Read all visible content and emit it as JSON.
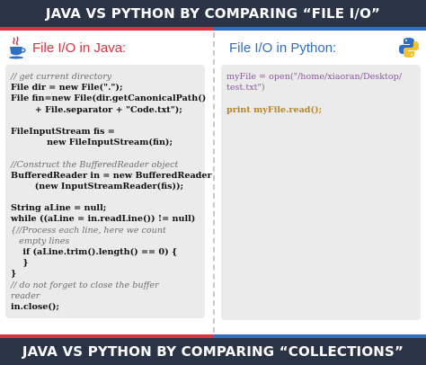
{
  "header": {
    "title": "JAVA VS PYTHON BY COMPARING “FILE I/O”"
  },
  "footer": {
    "title": "JAVA VS PYTHON BY COMPARING “COLLECTIONS”"
  },
  "colors": {
    "banner": "#2b3447",
    "java_accent": "#d9343f",
    "python_accent": "#2f6fc4",
    "code_bg": "#ebebeb"
  },
  "java": {
    "title": "File I/O in Java:",
    "icon": "java-cup-icon",
    "code_lines": [
      "// get current directory",
      "File dir = new File(\".\");",
      "File fin=new File(dir.getCanonicalPath()",
      "        + File.separator + \"Code.txt\");",
      "",
      "FileInputStream fis =",
      "            new FileInputStream(fin);",
      "",
      "//Construct the BufferedReader object",
      "BufferedReader in = new BufferedReader",
      "        (new InputStreamReader(fis));",
      "",
      "String aLine = null;",
      "while ((aLine = in.readLine()) != null)",
      "{//Process each line, here we count",
      "   empty lines",
      "    if (aLine.trim().length() == 0) {",
      "    }",
      "}",
      "// do not forget to close the buffer",
      "reader",
      "in.close();"
    ]
  },
  "python": {
    "title": "File I/O in Python:",
    "icon": "python-logo-icon",
    "code_lines": [
      "myFile = open(\"/home/xiaoran/Desktop/",
      "test.txt\")",
      "",
      "print myFile.read();"
    ]
  }
}
